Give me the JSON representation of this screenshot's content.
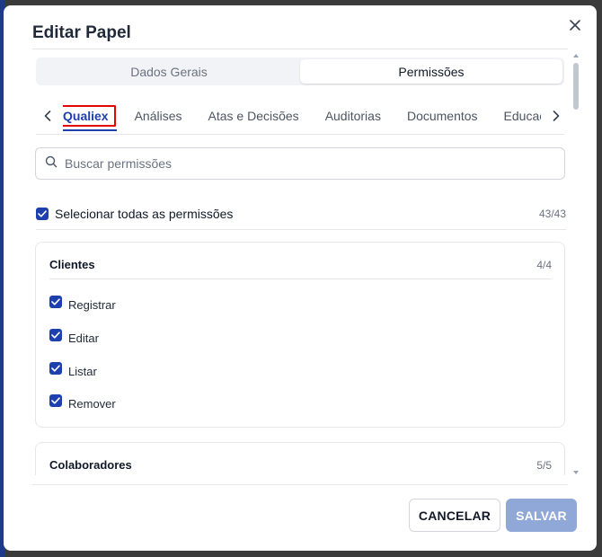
{
  "modal": {
    "title": "Editar Papel",
    "close_icon": "close-icon"
  },
  "segments": [
    {
      "label": "Dados Gerais",
      "active": false
    },
    {
      "label": "Permissões",
      "active": true
    }
  ],
  "tabs": [
    {
      "label": "Qualiex",
      "active": true
    },
    {
      "label": "Análises"
    },
    {
      "label": "Atas e Decisões"
    },
    {
      "label": "Auditorias"
    },
    {
      "label": "Documentos"
    },
    {
      "label": "Educação"
    }
  ],
  "search": {
    "placeholder": "Buscar permissões",
    "value": ""
  },
  "select_all": {
    "label": "Selecionar todas as permissões",
    "count": "43/43",
    "checked": true
  },
  "groups": [
    {
      "title": "Clientes",
      "count": "4/4",
      "permissions": [
        {
          "label": "Registrar",
          "checked": true
        },
        {
          "label": "Editar",
          "checked": true
        },
        {
          "label": "Listar",
          "checked": true
        },
        {
          "label": "Remover",
          "checked": true
        }
      ]
    },
    {
      "title": "Colaboradores",
      "count": "5/5",
      "permissions": []
    }
  ],
  "footer": {
    "cancel_label": "CANCELAR",
    "save_label": "SALVAR"
  },
  "colors": {
    "accent": "#1e40af",
    "save_button": "#8fa8d8",
    "highlight_box": "#e10600"
  }
}
